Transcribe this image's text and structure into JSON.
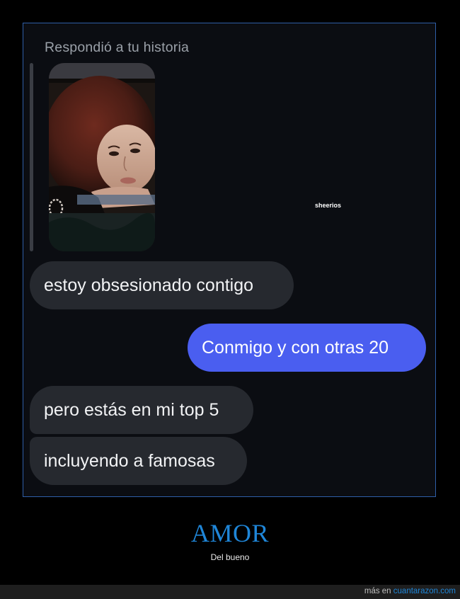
{
  "conversation": {
    "reply_label": "Respondió a tu historia",
    "story": {
      "thumbnail": "story-photo",
      "watermark": "sheerios"
    },
    "messages": [
      {
        "sender": "other",
        "text": "estoy obsesionado contigo"
      },
      {
        "sender": "me",
        "text": "Conmigo y con otras 20"
      },
      {
        "sender": "other",
        "text": "pero estás en mi top 5"
      },
      {
        "sender": "other",
        "text": "incluyendo a famosas"
      }
    ]
  },
  "caption": {
    "title": "AMOR",
    "subtitle": "Del bueno"
  },
  "footer": {
    "prefix": "más en",
    "link": "cuantarazon.com"
  },
  "colors": {
    "sent_bubble": "#4a5ef0",
    "received_bubble": "#26292f",
    "background": "#0b0d12",
    "caption_title": "#1f86d8",
    "frame_border": "#2f5fa8"
  }
}
